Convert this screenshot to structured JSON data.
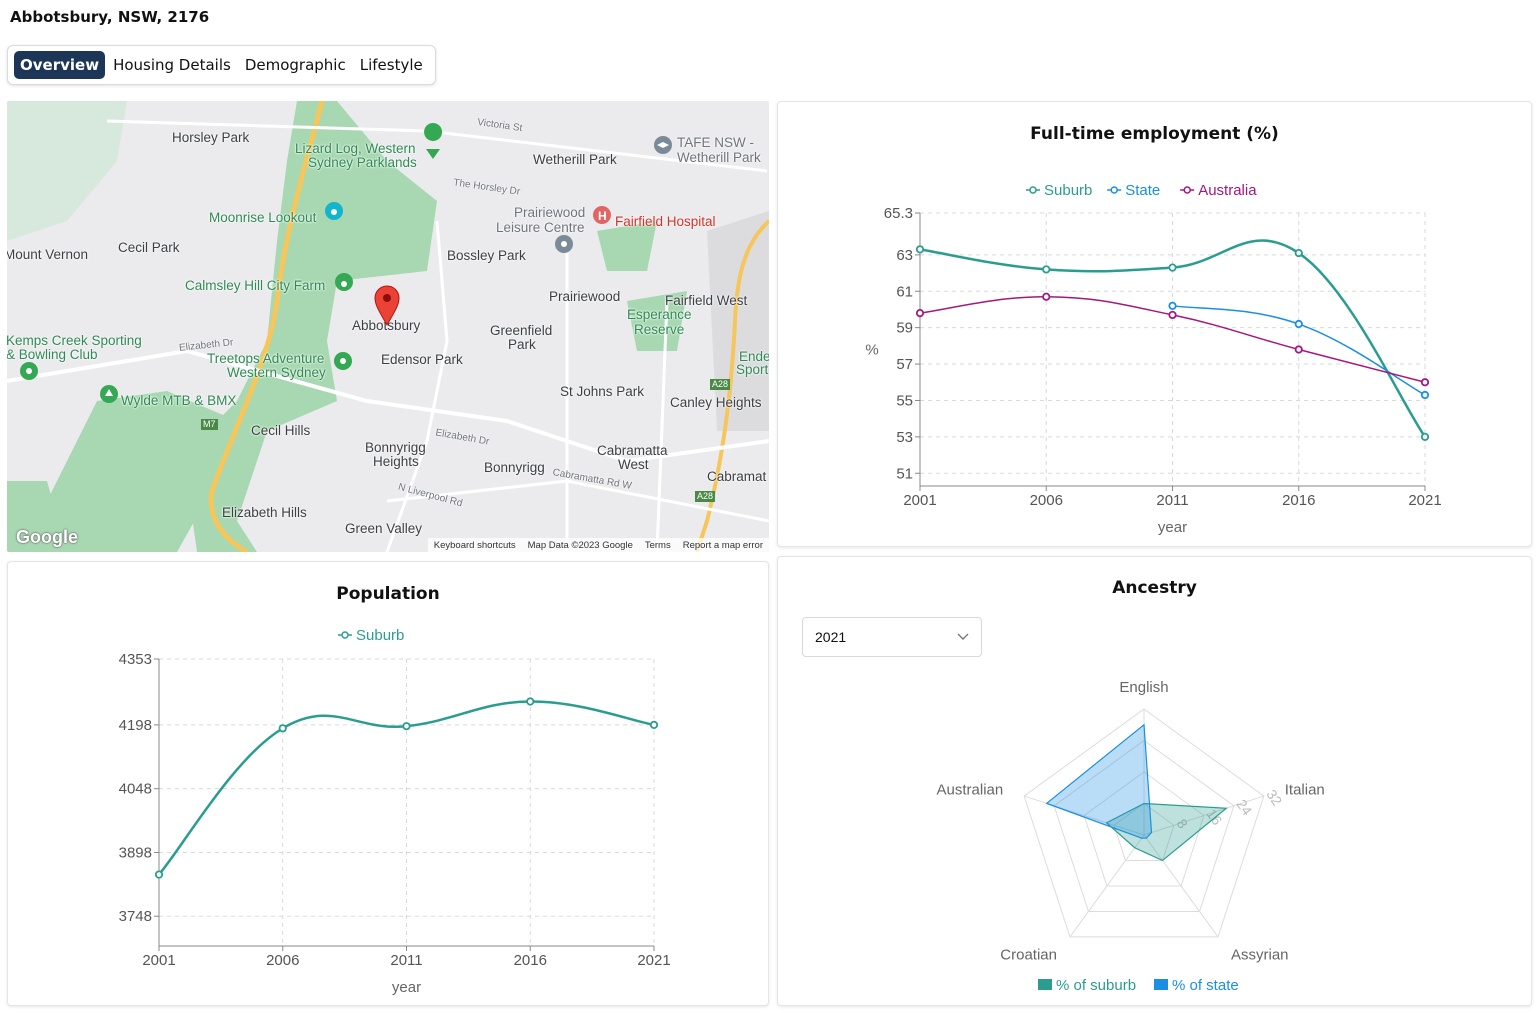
{
  "page": {
    "title": "Abbotsbury, NSW, 2176"
  },
  "tabs": [
    {
      "label": "Overview",
      "active": true
    },
    {
      "label": "Housing Details",
      "active": false
    },
    {
      "label": "Demographic",
      "active": false
    },
    {
      "label": "Lifestyle",
      "active": false
    }
  ],
  "map": {
    "labels": {
      "horsley_park": "Horsley Park",
      "lizard_log": "Lizard Log, Western",
      "lizard_log2": "Sydney Parklands",
      "wetherill_park": "Wetherill Park",
      "tafe": "TAFE NSW -",
      "tafe2": "Wetherill Park",
      "victoria_st": "Victoria St",
      "horsley_dr": "The Horsley Dr",
      "moonrise": "Moonrise Lookout",
      "prairiewood_leisure": "Prairiewood",
      "prairiewood_leisure2": "Leisure Centre",
      "fairfield_hospital": "Fairfield Hospital",
      "mount_vernon": "Mount Vernon",
      "cecil_park": "Cecil Park",
      "bossley_park": "Bossley Park",
      "calmsley": "Calmsley Hill City Farm",
      "prairiewood": "Prairiewood",
      "fairfield_west": "Fairfield West",
      "esperance": "Esperance",
      "esperance2": "Reserve",
      "abbotsbury": "Abbotsbury",
      "greenfield": "Greenfield",
      "greenfield2": "Park",
      "kemps_creek": "Kemps Creek Sporting",
      "kemps_creek2": "& Bowling Club",
      "treetops": "Treetops Adventure",
      "treetops2": "Western Sydney",
      "edensor_park": "Edensor Park",
      "endeavour": "Ende",
      "endeavour2": "Sport",
      "wylde": "Wylde MTB & BMX",
      "st_johns_park": "St Johns Park",
      "canley_heights": "Canley Heights",
      "cecil_hills": "Cecil Hills",
      "bonnyrigg_heights": "Bonnyrigg",
      "bonnyrigg_heights2": "Heights",
      "cabramatta_west": "Cabramatta",
      "cabramatta_west2": "West",
      "bonnyrigg": "Bonnyrigg",
      "cabramatta": "Cabramat",
      "elizabeth_hills": "Elizabeth Hills",
      "green_valley": "Green Valley",
      "elizabeth_dr": "Elizabeth Dr",
      "elizabeth_dr2": "Elizabeth Dr",
      "cabramatta_rd": "Cabramatta Rd W",
      "n_liverpool_rd": "N Liverpool Rd",
      "a28": "A28",
      "a28b": "A28",
      "m7": "M7"
    },
    "google_logo": "Google",
    "footer": {
      "shortcuts": "Keyboard shortcuts",
      "map_data": "Map Data ©2023 Google",
      "terms": "Terms",
      "report": "Report a map error"
    },
    "marker_icon": "map-pin-icon"
  },
  "employment_card": {
    "title": "Full-time employment (%)",
    "chart_data": {
      "type": "line",
      "title": "Full-time employment (%)",
      "xlabel": "year",
      "ylabel": "%",
      "x": [
        "2001",
        "2006",
        "2011",
        "2016",
        "2021"
      ],
      "yticks": [
        "51",
        "53",
        "55",
        "57",
        "59",
        "61",
        "63",
        "65.3"
      ],
      "ylim": [
        50.3,
        65.3
      ],
      "grid": true,
      "legend_position": "top",
      "series": [
        {
          "name": "Suburb",
          "color": "#2a9d8f",
          "values": [
            63.3,
            62.2,
            62.3,
            63.1,
            53.0
          ]
        },
        {
          "name": "State",
          "color": "#1a8fe3",
          "values": [
            null,
            null,
            60.2,
            59.2,
            55.3
          ]
        },
        {
          "name": "Australia",
          "color": "#a4177f",
          "values": [
            59.8,
            60.7,
            59.7,
            57.8,
            56.0
          ]
        }
      ]
    }
  },
  "population_card": {
    "title": "Population",
    "chart_data": {
      "type": "line",
      "title": "Population",
      "xlabel": "year",
      "ylabel": "",
      "x": [
        "2001",
        "2006",
        "2011",
        "2016",
        "2021"
      ],
      "yticks": [
        "3748",
        "3898",
        "4048",
        "4198",
        "4353"
      ],
      "ylim": [
        3678,
        4353
      ],
      "grid": true,
      "legend_position": "top",
      "series": [
        {
          "name": "Suburb",
          "color": "#2a9d8f",
          "values": [
            3846,
            4190,
            4195,
            4253,
            4198
          ]
        }
      ]
    }
  },
  "ancestry_card": {
    "title": "Ancestry",
    "year_select": {
      "value": "2021",
      "icon": "chevron-down-icon"
    },
    "chart_data": {
      "type": "radar",
      "title": "Ancestry",
      "indicators": [
        "English",
        "Italian",
        "Assyrian",
        "Croatian",
        "Australian"
      ],
      "max": 32,
      "scale_ticks": [
        "0",
        "8",
        "16",
        "24",
        "32"
      ],
      "legend_position": "bottom",
      "series": [
        {
          "name": "% of suburb",
          "color": "#2a9d8f",
          "values": [
            8,
            22,
            8,
            4,
            10
          ]
        },
        {
          "name": "% of state",
          "color": "#1a8fe3",
          "values": [
            28,
            2,
            1,
            1,
            26
          ]
        }
      ]
    }
  }
}
